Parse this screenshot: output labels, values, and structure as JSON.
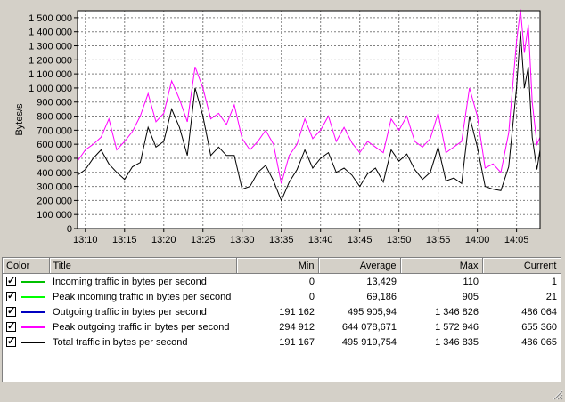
{
  "chart_data": {
    "type": "line",
    "ylabel": "Bytes/s",
    "ylim": [
      0,
      1550000
    ],
    "yticks": [
      {
        "v": 0,
        "label": "0"
      },
      {
        "v": 100000,
        "label": "100 000"
      },
      {
        "v": 200000,
        "label": "200 000"
      },
      {
        "v": 300000,
        "label": "300 000"
      },
      {
        "v": 400000,
        "label": "400 000"
      },
      {
        "v": 500000,
        "label": "500 000"
      },
      {
        "v": 600000,
        "label": "600 000"
      },
      {
        "v": 700000,
        "label": "700 000"
      },
      {
        "v": 800000,
        "label": "800 000"
      },
      {
        "v": 900000,
        "label": "900 000"
      },
      {
        "v": 1000000,
        "label": "1 000 000"
      },
      {
        "v": 1100000,
        "label": "1 100 000"
      },
      {
        "v": 1200000,
        "label": "1 200 000"
      },
      {
        "v": 1300000,
        "label": "1 300 000"
      },
      {
        "v": 1400000,
        "label": "1 400 000"
      },
      {
        "v": 1500000,
        "label": "1 500 000"
      }
    ],
    "xlim": [
      789,
      848
    ],
    "xticks": [
      {
        "v": 790,
        "label": "13:10"
      },
      {
        "v": 795,
        "label": "13:15"
      },
      {
        "v": 800,
        "label": "13:20"
      },
      {
        "v": 805,
        "label": "13:25"
      },
      {
        "v": 810,
        "label": "13:30"
      },
      {
        "v": 815,
        "label": "13:35"
      },
      {
        "v": 820,
        "label": "13:40"
      },
      {
        "v": 825,
        "label": "13:45"
      },
      {
        "v": 830,
        "label": "13:50"
      },
      {
        "v": 835,
        "label": "13:55"
      },
      {
        "v": 840,
        "label": "14:00"
      },
      {
        "v": 845,
        "label": "14:05"
      }
    ],
    "grid": true,
    "series": [
      {
        "name": "Peak outgoing traffic in bytes per second",
        "color": "#ff00ff",
        "points": [
          [
            789,
            480000
          ],
          [
            790,
            560000
          ],
          [
            791,
            600000
          ],
          [
            792,
            650000
          ],
          [
            793,
            780000
          ],
          [
            794,
            560000
          ],
          [
            795,
            620000
          ],
          [
            796,
            690000
          ],
          [
            797,
            800000
          ],
          [
            798,
            960000
          ],
          [
            799,
            760000
          ],
          [
            800,
            820000
          ],
          [
            801,
            1050000
          ],
          [
            802,
            920000
          ],
          [
            803,
            760000
          ],
          [
            804,
            1150000
          ],
          [
            805,
            1000000
          ],
          [
            806,
            780000
          ],
          [
            807,
            820000
          ],
          [
            808,
            740000
          ],
          [
            809,
            880000
          ],
          [
            810,
            640000
          ],
          [
            811,
            560000
          ],
          [
            812,
            620000
          ],
          [
            813,
            700000
          ],
          [
            814,
            600000
          ],
          [
            815,
            320000
          ],
          [
            816,
            520000
          ],
          [
            817,
            600000
          ],
          [
            818,
            780000
          ],
          [
            819,
            640000
          ],
          [
            820,
            700000
          ],
          [
            821,
            800000
          ],
          [
            822,
            620000
          ],
          [
            823,
            720000
          ],
          [
            824,
            610000
          ],
          [
            825,
            540000
          ],
          [
            826,
            620000
          ],
          [
            827,
            580000
          ],
          [
            828,
            540000
          ],
          [
            829,
            780000
          ],
          [
            830,
            700000
          ],
          [
            831,
            800000
          ],
          [
            832,
            620000
          ],
          [
            833,
            580000
          ],
          [
            834,
            640000
          ],
          [
            835,
            820000
          ],
          [
            836,
            540000
          ],
          [
            837,
            580000
          ],
          [
            838,
            620000
          ],
          [
            839,
            1000000
          ],
          [
            840,
            800000
          ],
          [
            841,
            430000
          ],
          [
            842,
            460000
          ],
          [
            843,
            400000
          ],
          [
            844,
            680000
          ],
          [
            845,
            1330000
          ],
          [
            845.5,
            1560000
          ],
          [
            846,
            1250000
          ],
          [
            846.5,
            1450000
          ],
          [
            847,
            900000
          ],
          [
            847.6,
            600000
          ],
          [
            848,
            650000
          ]
        ]
      },
      {
        "name": "Total traffic in bytes per second",
        "color": "#000000",
        "points": [
          [
            789,
            380000
          ],
          [
            790,
            420000
          ],
          [
            791,
            500000
          ],
          [
            792,
            560000
          ],
          [
            793,
            460000
          ],
          [
            794,
            400000
          ],
          [
            795,
            350000
          ],
          [
            796,
            440000
          ],
          [
            797,
            470000
          ],
          [
            798,
            720000
          ],
          [
            799,
            580000
          ],
          [
            800,
            620000
          ],
          [
            801,
            850000
          ],
          [
            802,
            720000
          ],
          [
            803,
            520000
          ],
          [
            804,
            1000000
          ],
          [
            805,
            800000
          ],
          [
            806,
            520000
          ],
          [
            807,
            580000
          ],
          [
            808,
            520000
          ],
          [
            809,
            520000
          ],
          [
            810,
            280000
          ],
          [
            811,
            300000
          ],
          [
            812,
            400000
          ],
          [
            813,
            450000
          ],
          [
            814,
            340000
          ],
          [
            815,
            200000
          ],
          [
            816,
            330000
          ],
          [
            817,
            420000
          ],
          [
            818,
            560000
          ],
          [
            819,
            430000
          ],
          [
            820,
            500000
          ],
          [
            821,
            540000
          ],
          [
            822,
            400000
          ],
          [
            823,
            430000
          ],
          [
            824,
            380000
          ],
          [
            825,
            300000
          ],
          [
            826,
            390000
          ],
          [
            827,
            430000
          ],
          [
            828,
            330000
          ],
          [
            829,
            560000
          ],
          [
            830,
            480000
          ],
          [
            831,
            530000
          ],
          [
            832,
            420000
          ],
          [
            833,
            350000
          ],
          [
            834,
            400000
          ],
          [
            835,
            580000
          ],
          [
            836,
            340000
          ],
          [
            837,
            360000
          ],
          [
            838,
            320000
          ],
          [
            839,
            800000
          ],
          [
            840,
            580000
          ],
          [
            841,
            300000
          ],
          [
            842,
            280000
          ],
          [
            843,
            270000
          ],
          [
            844,
            440000
          ],
          [
            845,
            1000000
          ],
          [
            845.5,
            1400000
          ],
          [
            846,
            1000000
          ],
          [
            846.5,
            1150000
          ],
          [
            847,
            650000
          ],
          [
            847.6,
            420000
          ],
          [
            848,
            560000
          ]
        ]
      }
    ]
  },
  "legend": {
    "headers": {
      "color": "Color",
      "title": "Title",
      "min": "Min",
      "average": "Average",
      "max": "Max",
      "current": "Current"
    },
    "rows": [
      {
        "color": "#00c000",
        "title": "Incoming traffic in bytes per second",
        "min": "0",
        "average": "13,429",
        "max": "110",
        "current": "1"
      },
      {
        "color": "#00ff00",
        "title": "Peak incoming traffic in bytes per second",
        "min": "0",
        "average": "69,186",
        "max": "905",
        "current": "21"
      },
      {
        "color": "#0000c0",
        "title": "Outgoing traffic in bytes per second",
        "min": "191 162",
        "average": "495 905,94",
        "max": "1 346 826",
        "current": "486 064"
      },
      {
        "color": "#ff00ff",
        "title": "Peak outgoing traffic in bytes per second",
        "min": "294 912",
        "average": "644 078,671",
        "max": "1 572 946",
        "current": "655 360"
      },
      {
        "color": "#000000",
        "title": "Total traffic in bytes per second",
        "min": "191 167",
        "average": "495 919,754",
        "max": "1 346 835",
        "current": "486 065"
      }
    ]
  }
}
